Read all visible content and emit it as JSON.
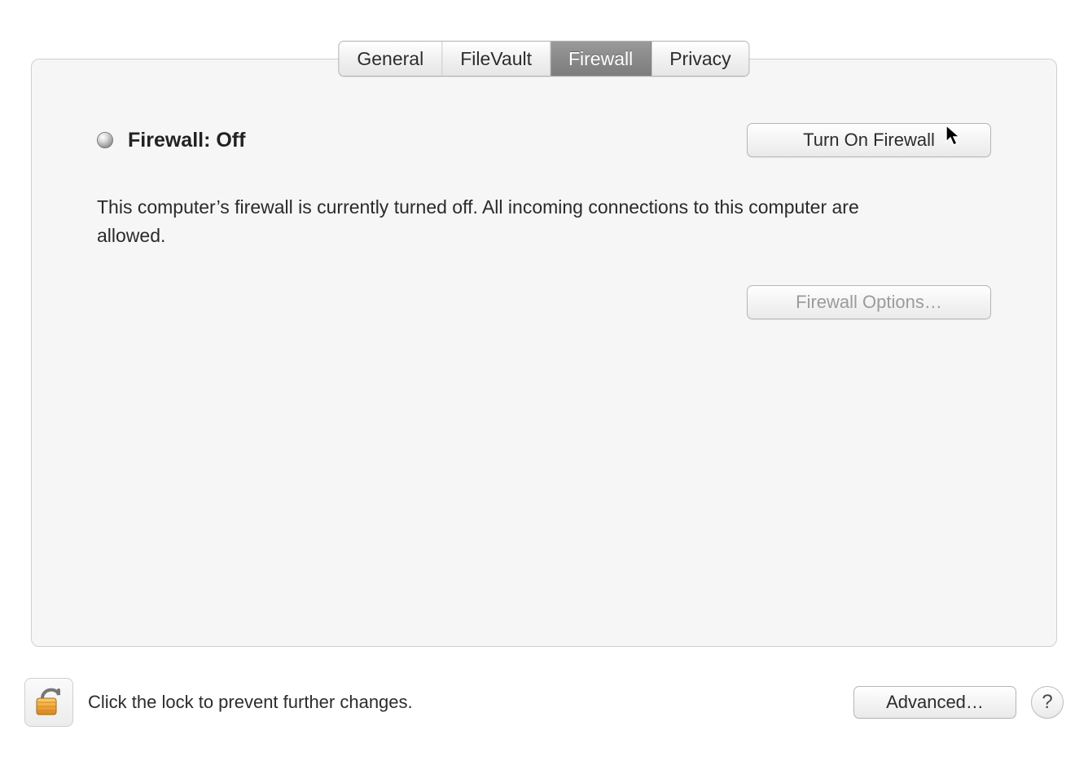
{
  "tabs": {
    "items": [
      {
        "label": "General",
        "active": false
      },
      {
        "label": "FileVault",
        "active": false
      },
      {
        "label": "Firewall",
        "active": true
      },
      {
        "label": "Privacy",
        "active": false
      }
    ]
  },
  "main": {
    "status_indicator": "off",
    "status_title": "Firewall: Off",
    "turn_on_label": "Turn On Firewall",
    "description": "This computer’s firewall is currently turned off. All incoming connections to this computer are allowed.",
    "options_label": "Firewall Options…",
    "options_enabled": false
  },
  "footer": {
    "lock_text": "Click the lock to prevent further changes.",
    "advanced_label": "Advanced…",
    "help_label": "?"
  }
}
